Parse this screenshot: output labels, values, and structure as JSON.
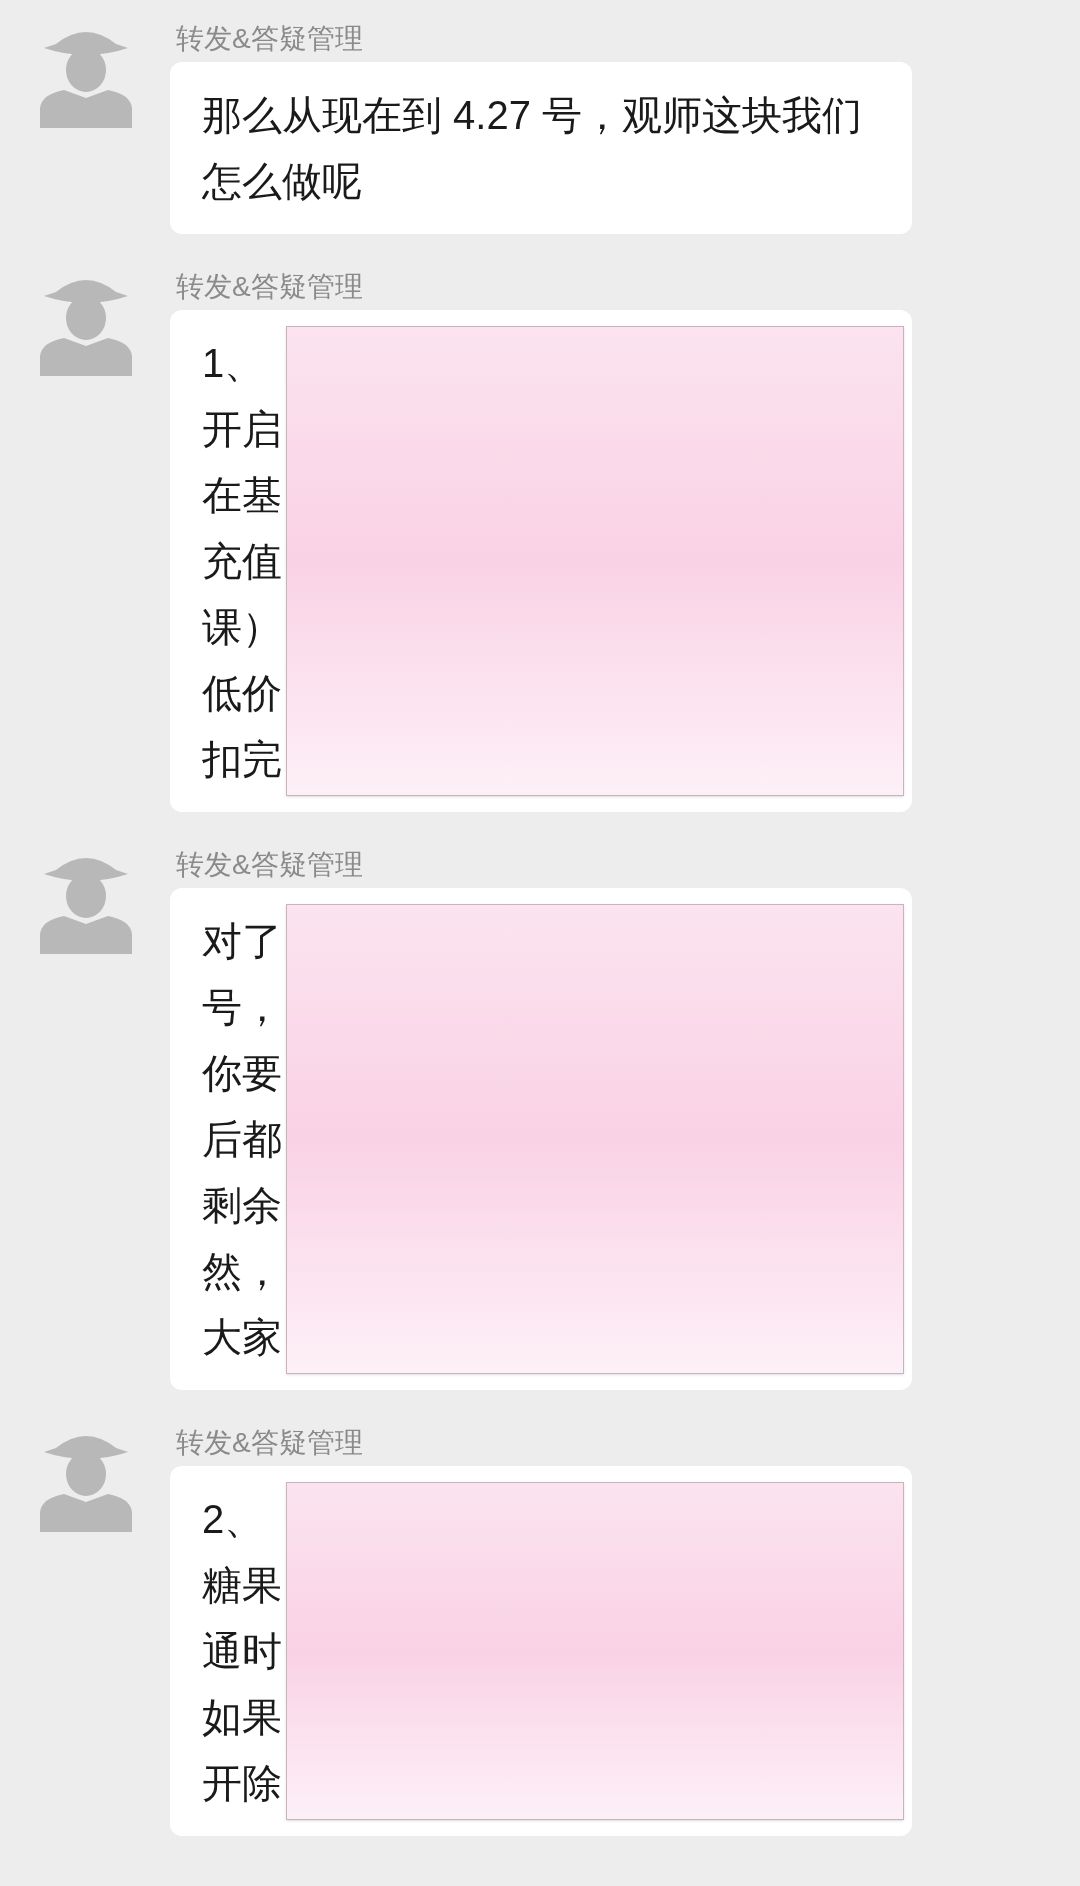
{
  "messages": [
    {
      "sender": "转发&答疑管理",
      "text": "那么从现在到 4.27 号，观师这块我们怎么做呢",
      "redacted": false
    },
    {
      "sender": "转发&答疑管理",
      "lines": [
        "1、",
        "开启",
        "在基",
        "充值",
        "课）",
        "低价",
        "扣完"
      ],
      "redacted": true
    },
    {
      "sender": "转发&答疑管理",
      "lines": [
        "对了",
        "号，",
        "你要",
        "后都",
        "剩余",
        "然，",
        "大家"
      ],
      "redacted": true
    },
    {
      "sender": "转发&答疑管理",
      "lines": [
        "2、",
        "糖果",
        "通时",
        "如果",
        "开除"
      ],
      "redacted": true
    }
  ]
}
